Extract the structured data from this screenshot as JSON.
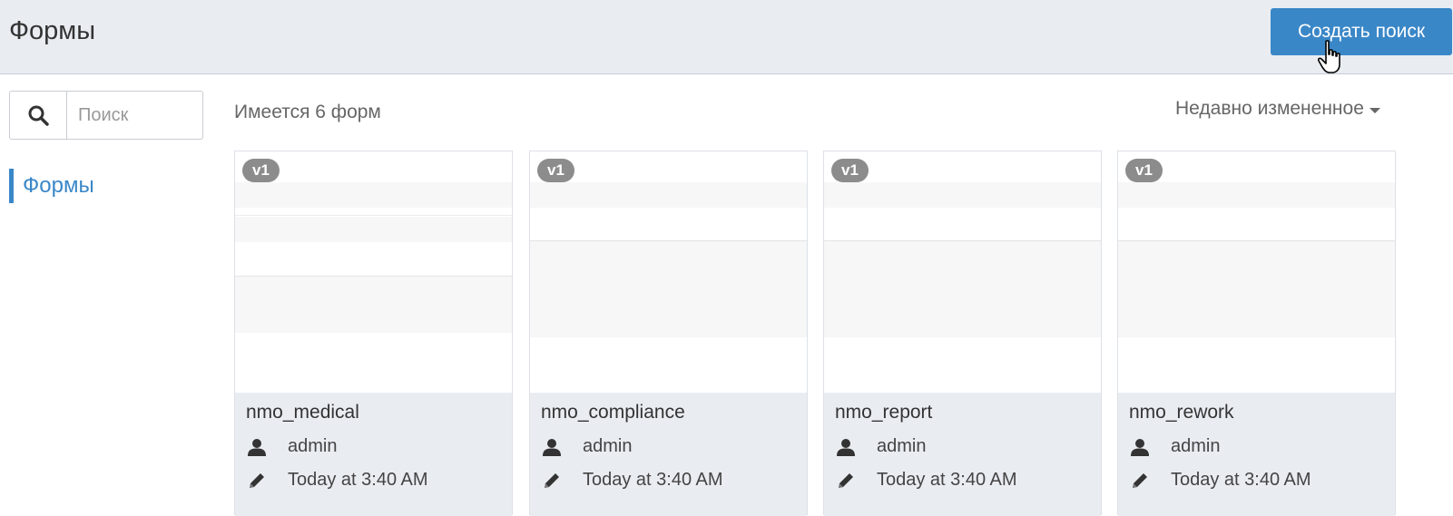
{
  "header": {
    "title": "Формы",
    "create_label": "Создать поиск"
  },
  "sidebar": {
    "search_placeholder": "Поиск",
    "nav_label": "Формы"
  },
  "content": {
    "count_text": "Имеется 6 форм",
    "sort_label": "Недавно измененное"
  },
  "cards": [
    {
      "name": "nmo_medical",
      "version": "v1",
      "author": "admin",
      "modified": "Today at 3:40 AM"
    },
    {
      "name": "nmo_compliance",
      "version": "v1",
      "author": "admin",
      "modified": "Today at 3:40 AM"
    },
    {
      "name": "nmo_report",
      "version": "v1",
      "author": "admin",
      "modified": "Today at 3:40 AM"
    },
    {
      "name": "nmo_rework",
      "version": "v1",
      "author": "admin",
      "modified": "Today at 3:40 AM"
    }
  ],
  "colors": {
    "accent": "#3a87c8",
    "header_bg": "#e9edf2",
    "badge_bg": "#8c8c8c"
  },
  "icons": {
    "search": "search-icon",
    "user": "user-icon",
    "edit": "pencil-icon",
    "cursor": "hand-cursor-icon"
  }
}
